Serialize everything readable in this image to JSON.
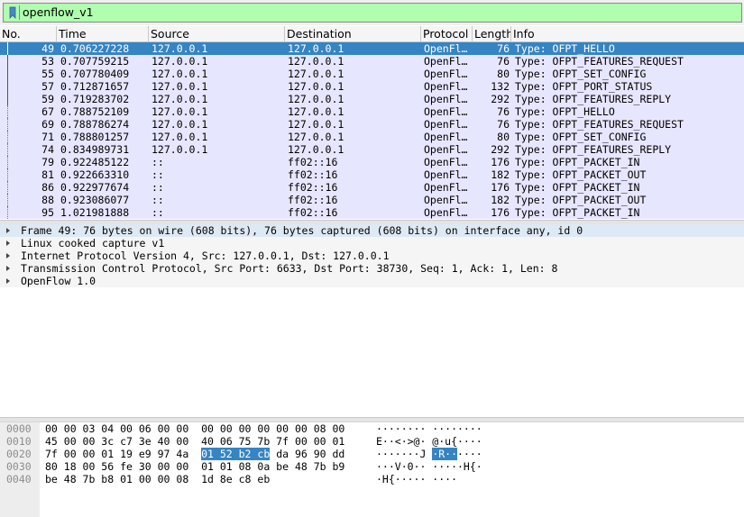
{
  "filter": {
    "value": "openflow_v1",
    "bookmark_icon": "bookmark-icon"
  },
  "columns": [
    "No.",
    "Time",
    "Source",
    "Destination",
    "Protocol",
    "Length",
    "Info"
  ],
  "packets": [
    {
      "no": "49",
      "time": "0.706227228",
      "src": "127.0.0.1",
      "dst": "127.0.0.1",
      "proto": "OpenFl…",
      "len": "76",
      "info": "Type: OFPT_HELLO",
      "selected": true
    },
    {
      "no": "53",
      "time": "0.707759215",
      "src": "127.0.0.1",
      "dst": "127.0.0.1",
      "proto": "OpenFl…",
      "len": "76",
      "info": "Type: OFPT_FEATURES_REQUEST"
    },
    {
      "no": "55",
      "time": "0.707780409",
      "src": "127.0.0.1",
      "dst": "127.0.0.1",
      "proto": "OpenFl…",
      "len": "80",
      "info": "Type: OFPT_SET_CONFIG"
    },
    {
      "no": "57",
      "time": "0.712871657",
      "src": "127.0.0.1",
      "dst": "127.0.0.1",
      "proto": "OpenFl…",
      "len": "132",
      "info": "Type: OFPT_PORT_STATUS"
    },
    {
      "no": "59",
      "time": "0.719283702",
      "src": "127.0.0.1",
      "dst": "127.0.0.1",
      "proto": "OpenFl…",
      "len": "292",
      "info": "Type: OFPT_FEATURES_REPLY"
    },
    {
      "no": "67",
      "time": "0.788752109",
      "src": "127.0.0.1",
      "dst": "127.0.0.1",
      "proto": "OpenFl…",
      "len": "76",
      "info": "Type: OFPT_HELLO"
    },
    {
      "no": "69",
      "time": "0.788786274",
      "src": "127.0.0.1",
      "dst": "127.0.0.1",
      "proto": "OpenFl…",
      "len": "76",
      "info": "Type: OFPT_FEATURES_REQUEST"
    },
    {
      "no": "71",
      "time": "0.788801257",
      "src": "127.0.0.1",
      "dst": "127.0.0.1",
      "proto": "OpenFl…",
      "len": "80",
      "info": "Type: OFPT_SET_CONFIG"
    },
    {
      "no": "74",
      "time": "0.834989731",
      "src": "127.0.0.1",
      "dst": "127.0.0.1",
      "proto": "OpenFl…",
      "len": "292",
      "info": "Type: OFPT_FEATURES_REPLY"
    },
    {
      "no": "79",
      "time": "0.922485122",
      "src": "::",
      "dst": "ff02::16",
      "proto": "OpenFl…",
      "len": "176",
      "info": "Type: OFPT_PACKET_IN"
    },
    {
      "no": "81",
      "time": "0.922663310",
      "src": "::",
      "dst": "ff02::16",
      "proto": "OpenFl…",
      "len": "182",
      "info": "Type: OFPT_PACKET_OUT"
    },
    {
      "no": "86",
      "time": "0.922977674",
      "src": "::",
      "dst": "ff02::16",
      "proto": "OpenFl…",
      "len": "176",
      "info": "Type: OFPT_PACKET_IN"
    },
    {
      "no": "88",
      "time": "0.923086077",
      "src": "::",
      "dst": "ff02::16",
      "proto": "OpenFl…",
      "len": "182",
      "info": "Type: OFPT_PACKET_OUT"
    },
    {
      "no": "95",
      "time": "1.021981888",
      "src": "::",
      "dst": "ff02::16",
      "proto": "OpenFl…",
      "len": "176",
      "info": "Type: OFPT_PACKET_IN"
    }
  ],
  "details": [
    {
      "text": "Frame 49: 76 bytes on wire (608 bits), 76 bytes captured (608 bits) on interface any, id 0",
      "selected": true
    },
    {
      "text": "Linux cooked capture v1"
    },
    {
      "text": "Internet Protocol Version 4, Src: 127.0.0.1, Dst: 127.0.0.1"
    },
    {
      "text": "Transmission Control Protocol, Src Port: 6633, Dst Port: 38730, Seq: 1, Ack: 1, Len: 8"
    },
    {
      "text": "OpenFlow 1.0"
    }
  ],
  "bytes": [
    {
      "offset": "0000",
      "hex_pre": "00 00 03 04 00 06 00 00  00 00 00 00 00 00 08 00",
      "hex_hl": "",
      "hex_post": "",
      "ascii_pre": "········ ········",
      "ascii_hl": "",
      "ascii_post": ""
    },
    {
      "offset": "0010",
      "hex_pre": "45 00 00 3c c7 3e 40 00  40 06 75 7b 7f 00 00 01",
      "hex_hl": "",
      "hex_post": "",
      "ascii_pre": "E··<·>@· @·u{····",
      "ascii_hl": "",
      "ascii_post": ""
    },
    {
      "offset": "0020",
      "hex_pre": "7f 00 00 01 19 e9 97 4a  ",
      "hex_hl": "01 52 b2 cb",
      "hex_post": " da 96 90 dd",
      "ascii_pre": "·······J ",
      "ascii_hl": "·R··",
      "ascii_post": "····"
    },
    {
      "offset": "0030",
      "hex_pre": "80 18 00 56 fe 30 00 00  01 01 08 0a be 48 7b b9",
      "hex_hl": "",
      "hex_post": "",
      "ascii_pre": "···V·0·· ·····H{·",
      "ascii_hl": "",
      "ascii_post": ""
    },
    {
      "offset": "0040",
      "hex_pre": "be 48 7b b8 01 00 00 08  1d 8e c8 eb",
      "hex_hl": "",
      "hex_post": "",
      "ascii_pre": "·H{····· ····",
      "ascii_hl": "",
      "ascii_post": ""
    }
  ]
}
